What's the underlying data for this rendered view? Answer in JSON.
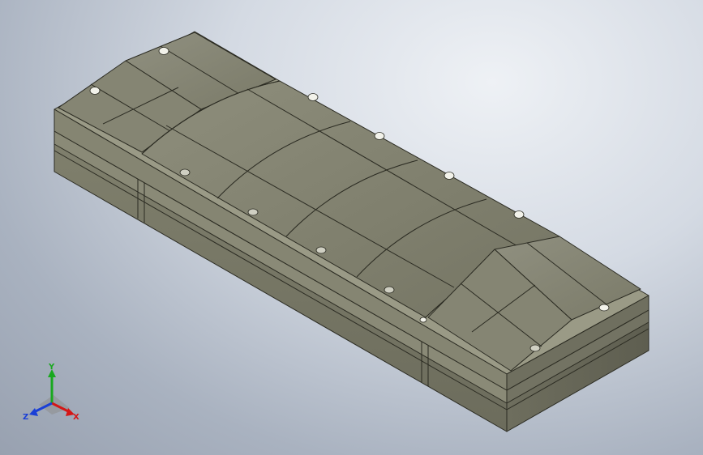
{
  "viewport": {
    "background_center": "#eef1f5",
    "background_edge": "#98a1b0"
  },
  "model": {
    "body_color": "#7c7c6a",
    "top_color": "#8a8a78",
    "edge_color": "#2b2b22",
    "fastener_color": "#f2f2ea"
  },
  "triad": {
    "axis_y": "Y",
    "axis_x": "X",
    "axis_z": "Z",
    "color_y": "#19a81f",
    "color_x": "#d41616",
    "color_z": "#1a3fd6"
  }
}
